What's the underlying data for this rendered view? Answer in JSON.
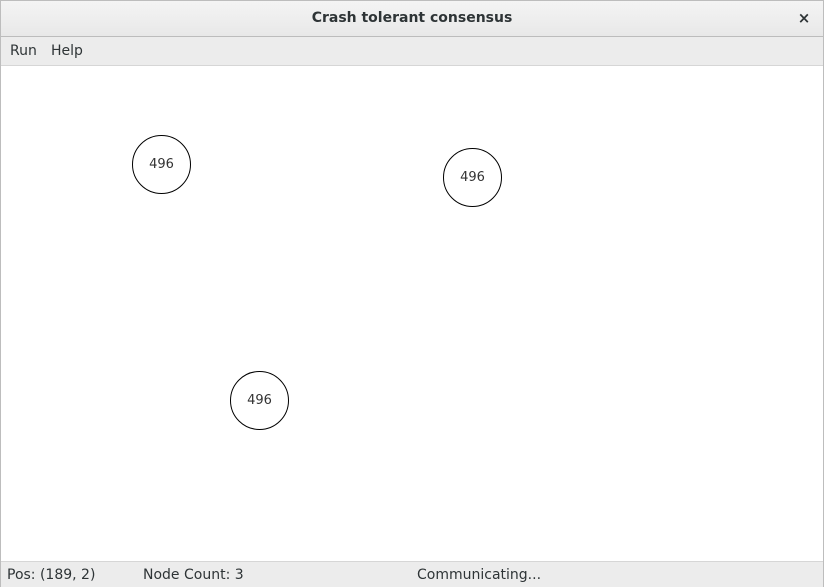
{
  "window": {
    "title": "Crash tolerant consensus",
    "close_glyph": "×"
  },
  "menu": {
    "items": [
      "Run",
      "Help"
    ]
  },
  "nodes": [
    {
      "value": "496"
    },
    {
      "value": "496"
    },
    {
      "value": "496"
    }
  ],
  "status": {
    "pos": "Pos: (189, 2)",
    "node_count": "Node Count: 3",
    "state": "Communicating..."
  }
}
